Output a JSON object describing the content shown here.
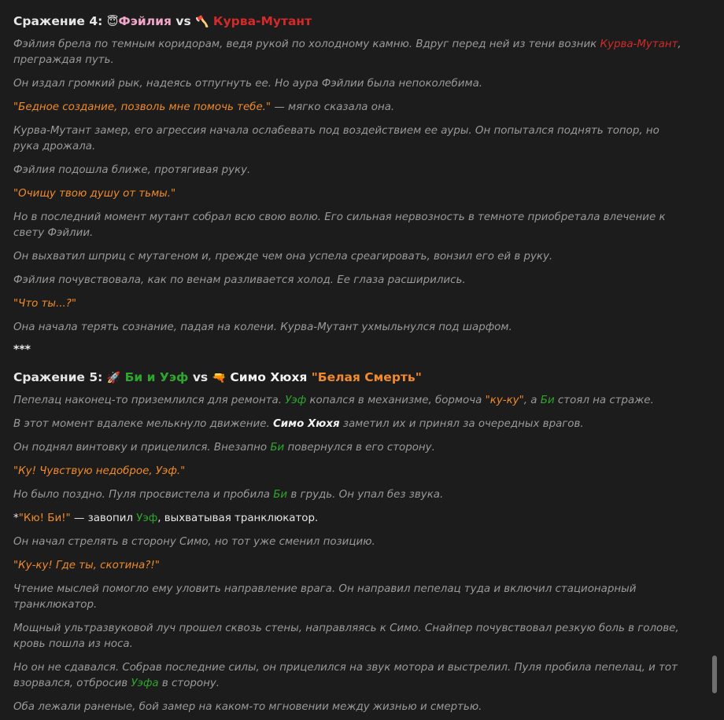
{
  "battle4": {
    "heading": [
      {
        "text": "Сражение 4: ",
        "cls": ""
      },
      {
        "text": "😇",
        "cls": "emoji"
      },
      {
        "text": "Фэйлия",
        "cls": "c-pink"
      },
      {
        "text": " vs ",
        "cls": ""
      },
      {
        "text": "🪓",
        "cls": "emoji"
      },
      {
        "text": " Курва-Мутант",
        "cls": "c-red"
      }
    ],
    "paragraphs": [
      {
        "style": "narr",
        "runs": [
          {
            "text": "Фэйлия брела по темным коридорам, ведя рукой по холодному камню. Вдруг перед ней из тени возник ",
            "cls": ""
          },
          {
            "text": "Курва-Мутант",
            "cls": "c-red"
          },
          {
            "text": ", преграждая путь.",
            "cls": ""
          }
        ]
      },
      {
        "style": "narr",
        "runs": [
          {
            "text": "Он издал громкий рык, надеясь отпугнуть ее. Но аура Фэйлии была непоколебима.",
            "cls": ""
          }
        ]
      },
      {
        "style": "narr",
        "runs": [
          {
            "text": "\"Бедное создание, позволь мне помочь тебе.\"",
            "cls": "c-orange"
          },
          {
            "text": " — мягко сказала она.",
            "cls": ""
          }
        ]
      },
      {
        "style": "narr",
        "runs": [
          {
            "text": "Курва-Мутант замер, его агрессия начала ослабевать под воздействием ее ауры. Он попытался поднять топор, но рука дрожала.",
            "cls": ""
          }
        ]
      },
      {
        "style": "narr",
        "runs": [
          {
            "text": "Фэйлия подошла ближе, протягивая руку.",
            "cls": ""
          }
        ]
      },
      {
        "style": "quote",
        "runs": [
          {
            "text": "\"Очищу твою душу от тьмы.\"",
            "cls": ""
          }
        ]
      },
      {
        "style": "narr",
        "runs": [
          {
            "text": "Но в последний момент мутант собрал всю свою волю. Его сильная нервозность в темноте приобретала влечение к свету Фэйлии.",
            "cls": ""
          }
        ]
      },
      {
        "style": "narr",
        "runs": [
          {
            "text": "Он выхватил шприц с мутагеном и, прежде чем она успела среагировать, вонзил его ей в руку.",
            "cls": ""
          }
        ]
      },
      {
        "style": "narr",
        "runs": [
          {
            "text": "Фэйлия почувствовала, как по венам разливается холод. Ее глаза расширились.",
            "cls": ""
          }
        ]
      },
      {
        "style": "quote",
        "runs": [
          {
            "text": "\"Что ты...?\"",
            "cls": ""
          }
        ]
      },
      {
        "style": "narr",
        "runs": [
          {
            "text": "Она начала терять сознание, падая на колени. Курва-Мутант ухмыльнулся под шарфом.",
            "cls": ""
          }
        ]
      }
    ],
    "separator": "***"
  },
  "battle5": {
    "heading": [
      {
        "text": "Сражение 5: ",
        "cls": ""
      },
      {
        "text": "🚀",
        "cls": "emoji"
      },
      {
        "text": " Би и Уэф",
        "cls": "c-green"
      },
      {
        "text": " vs ",
        "cls": ""
      },
      {
        "text": "🔫",
        "cls": "emoji"
      },
      {
        "text": " Симо Хюхя ",
        "cls": "c-white"
      },
      {
        "text": "\"Белая Смерть\"",
        "cls": "c-orange"
      }
    ],
    "paragraphs": [
      {
        "style": "narr",
        "runs": [
          {
            "text": "Пепелац наконец-то приземлился для ремонта. ",
            "cls": ""
          },
          {
            "text": "Уэф",
            "cls": "c-green"
          },
          {
            "text": " копался в механизме, бормоча ",
            "cls": ""
          },
          {
            "text": "\"ку-ку\"",
            "cls": "c-orange"
          },
          {
            "text": ", а ",
            "cls": ""
          },
          {
            "text": "Би",
            "cls": "c-green"
          },
          {
            "text": " стоял на страже.",
            "cls": ""
          }
        ]
      },
      {
        "style": "narr",
        "runs": [
          {
            "text": "В этот момент вдалеке мелькнуло движение. ",
            "cls": ""
          },
          {
            "text": "Симо Хюхя",
            "cls": "c-white-bold"
          },
          {
            "text": " заметил их и принял за очередных врагов.",
            "cls": ""
          }
        ]
      },
      {
        "style": "narr",
        "runs": [
          {
            "text": "Он поднял винтовку и прицелился. Внезапно ",
            "cls": ""
          },
          {
            "text": "Би",
            "cls": "c-green"
          },
          {
            "text": " повернулся в его сторону.",
            "cls": ""
          }
        ]
      },
      {
        "style": "quote",
        "runs": [
          {
            "text": "\"Ку! Чувствую недоброе, Уэф.\"",
            "cls": ""
          }
        ]
      },
      {
        "style": "narr",
        "runs": [
          {
            "text": "Но было поздно. Пуля просвистела и пробила ",
            "cls": ""
          },
          {
            "text": "Би",
            "cls": "c-green"
          },
          {
            "text": " в грудь. Он упал без звука.",
            "cls": ""
          }
        ]
      },
      {
        "style": "normal",
        "runs": [
          {
            "text": "*",
            "cls": ""
          },
          {
            "text": "\"Кю! Би!\"",
            "cls": "c-orange"
          },
          {
            "text": " — завопил ",
            "cls": ""
          },
          {
            "text": "Уэф",
            "cls": "c-green"
          },
          {
            "text": ", выхватывая транклюкатор.",
            "cls": ""
          }
        ]
      },
      {
        "style": "narr",
        "runs": [
          {
            "text": "Он начал стрелять в сторону Симо, но тот уже сменил позицию.",
            "cls": ""
          }
        ]
      },
      {
        "style": "quote",
        "runs": [
          {
            "text": "\"Ку-ку! Где ты, скотина?!\"",
            "cls": ""
          }
        ]
      },
      {
        "style": "narr",
        "runs": [
          {
            "text": "Чтение мыслей помогло ему уловить направление врага. Он направил пепелац туда и включил стационарный транклюкатор.",
            "cls": ""
          }
        ]
      },
      {
        "style": "narr",
        "runs": [
          {
            "text": "Мощный ультразвуковой луч прошел сквозь стены, направляясь к Симо. Снайпер почувствовал резкую боль в голове, кровь пошла из носа.",
            "cls": ""
          }
        ]
      },
      {
        "style": "narr",
        "runs": [
          {
            "text": "Но он не сдавался. Собрав последние силы, он прицелился на звук мотора и выстрелил. Пуля пробила пепелац, и тот взорвался, отбросив ",
            "cls": ""
          },
          {
            "text": "Уэфа",
            "cls": "c-green"
          },
          {
            "text": " в сторону.",
            "cls": ""
          }
        ]
      },
      {
        "style": "narr",
        "runs": [
          {
            "text": "Оба лежали раненые, бой замер на каком-то мгновении между жизнью и смертью.",
            "cls": ""
          }
        ]
      }
    ],
    "separator": "***"
  },
  "scrollbar": {
    "position": 0.91
  }
}
